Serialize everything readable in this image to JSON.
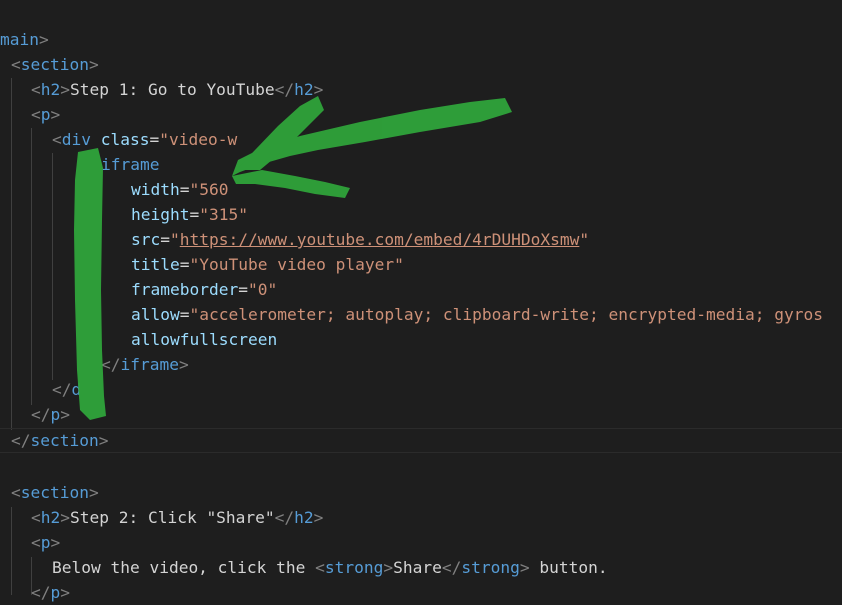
{
  "code": {
    "l1_tag": "main",
    "l2_tag": "section",
    "l3_tag": "h2",
    "l3_text": "Step 1: Go to YouTube",
    "l3_close": "h2",
    "l4_tag": "p",
    "l5_tag": "div",
    "l5_attr": "class",
    "l5_val": "\"video-w",
    "l6_tag": "iframe",
    "l7_attr": "width",
    "l7_val": "\"560",
    "l8_attr": "height",
    "l8_val": "\"315\"",
    "l9_attr": "src",
    "l9_q1": "\"",
    "l9_url": "https://www.youtube.com/embed/4rDUHDoXsmw",
    "l9_q2": "\"",
    "l10_attr": "title",
    "l10_val": "\"YouTube video player\"",
    "l11_attr": "frameborder",
    "l11_val": "\"0\"",
    "l12_attr": "allow",
    "l12_val": "\"accelerometer; autoplay; clipboard-write; encrypted-media; gyros",
    "l13_attr": "allowfullscreen",
    "l14_tag": "iframe",
    "l15_tag": "d",
    "l16_tag": "p",
    "l17_tag": "section",
    "l18_tag": "section",
    "l19_tag": "h2",
    "l19_text": "Step 2: Click \"Share\"",
    "l19_close": "h2",
    "l20_tag": "p",
    "l21_text1": "Below the video, click the ",
    "l21_strong": "strong",
    "l21_share": "Share",
    "l21_strong_close": "strong",
    "l21_text2": " button.",
    "l22_tag": "p"
  },
  "annotation": {
    "color": "#2fa23a",
    "shapes": [
      "arrow-stroke",
      "vertical-stroke"
    ]
  }
}
